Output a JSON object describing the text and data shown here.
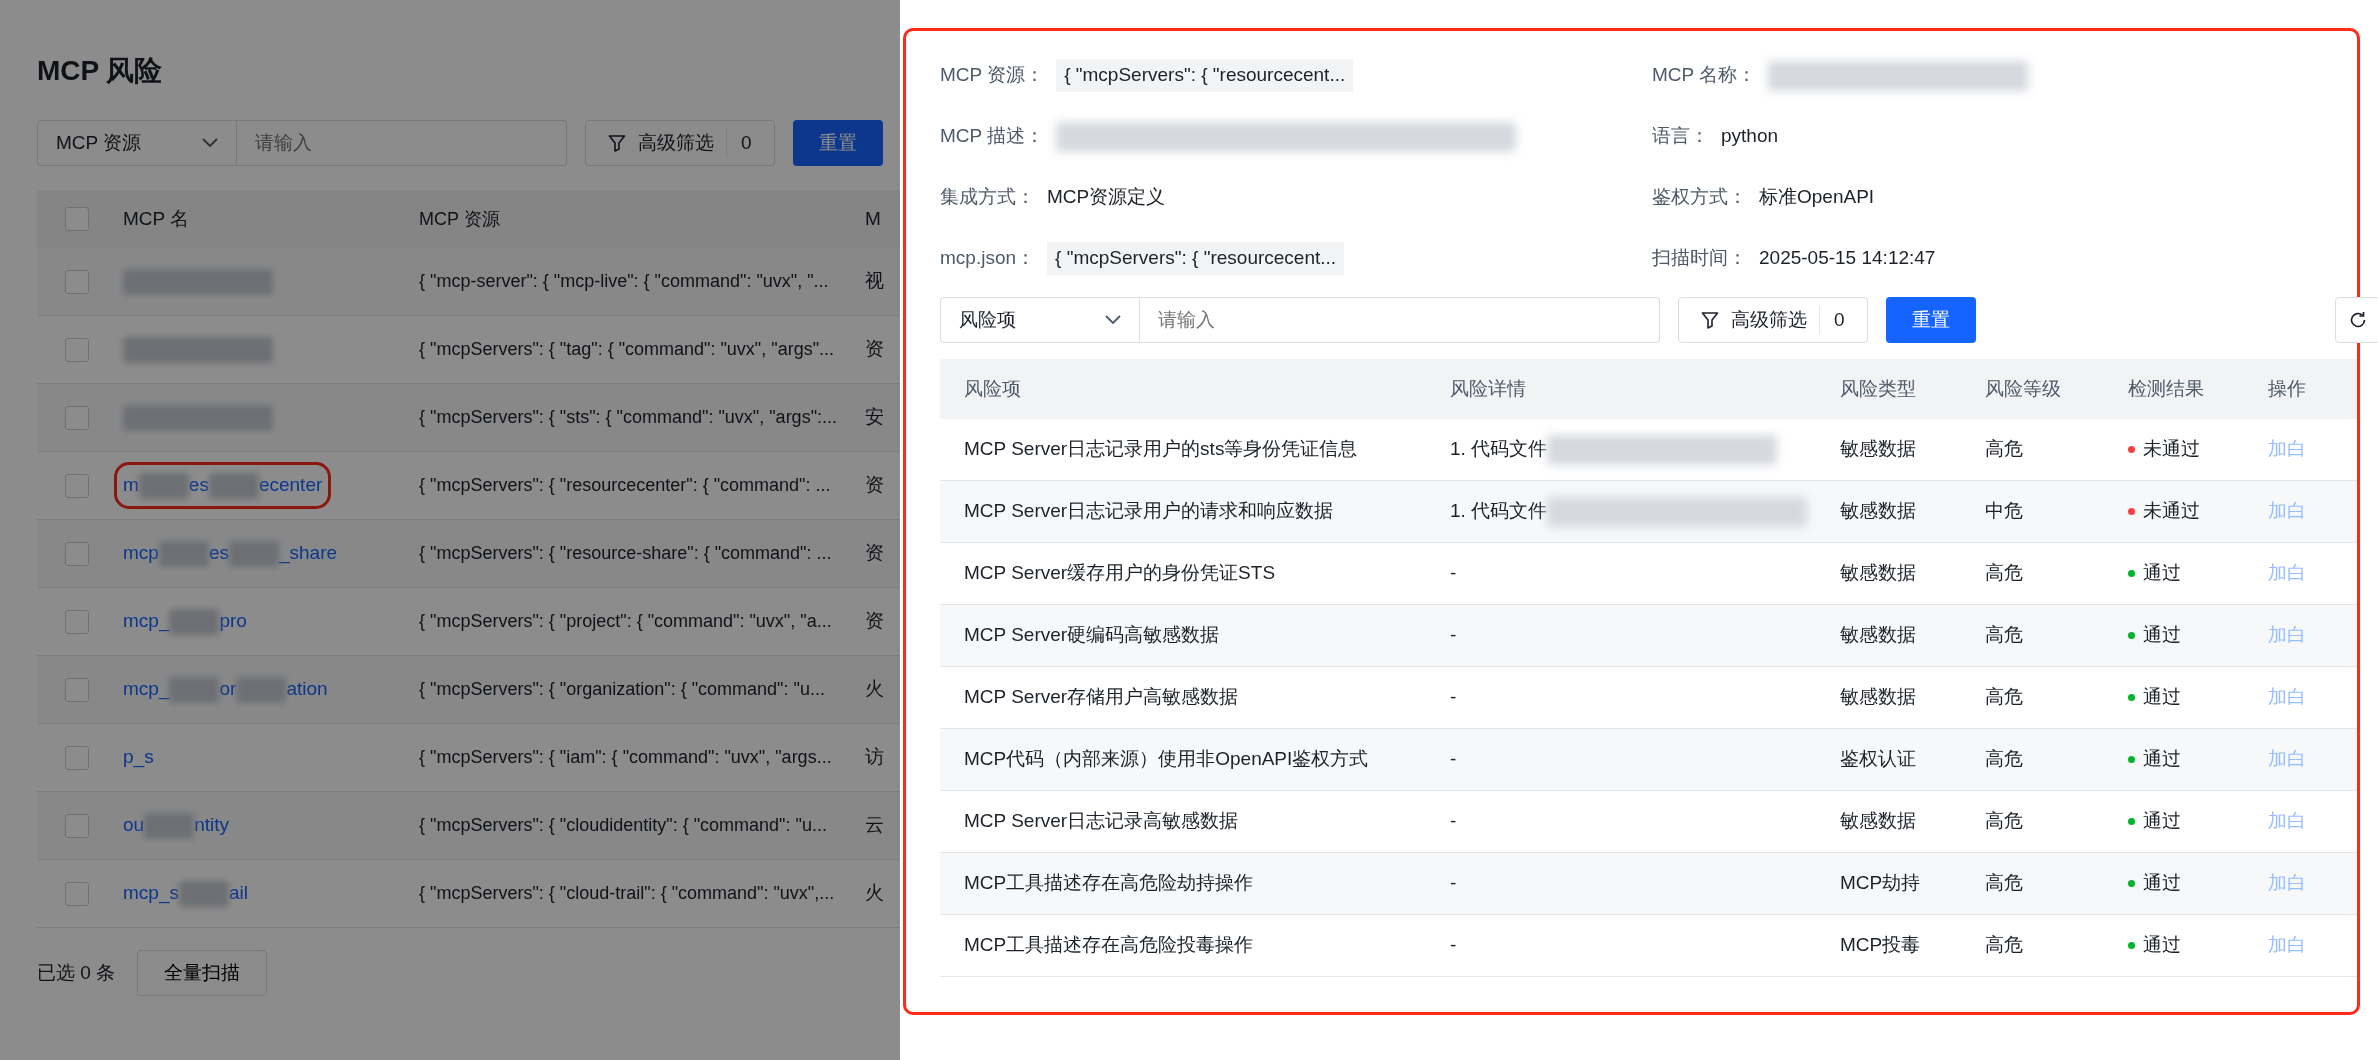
{
  "background_page": {
    "title": "MCP 风险",
    "filter": {
      "field_select": "MCP 资源",
      "placeholder": "请输入",
      "advanced_filter": "高级筛选",
      "filter_count": "0",
      "reset": "重置"
    },
    "table": {
      "select_all_checked": false,
      "columns": [
        "MCP 名",
        "MCP 资源",
        "M"
      ],
      "rows": [
        {
          "name_fragments": [],
          "resource": "{ \"mcp-server\": { \"mcp-live\": { \"command\": \"uvx\", \"...",
          "column_3": "视",
          "checked": false,
          "highlighted": false
        },
        {
          "name_fragments": [],
          "resource": "{ \"mcpServers\": { \"tag\": { \"command\": \"uvx\", \"args\"...",
          "column_3": "资",
          "checked": false,
          "highlighted": false
        },
        {
          "name_fragments": [],
          "resource": "{ \"mcpServers\": { \"sts\": { \"command\": \"uvx\", \"args\":...",
          "column_3": "安",
          "checked": false,
          "highlighted": false
        },
        {
          "name_fragments": [
            "m",
            "es",
            "ecenter"
          ],
          "resource": "{ \"mcpServers\": { \"resourcecenter\": { \"command\": ...",
          "column_3": "资",
          "checked": false,
          "highlighted": true
        },
        {
          "name_fragments": [
            "mcp",
            "es",
            "_share"
          ],
          "resource": "{ \"mcpServers\": { \"resource-share\": { \"command\": ...",
          "column_3": "资",
          "checked": false,
          "highlighted": false
        },
        {
          "name_fragments": [
            "mcp_",
            "pro"
          ],
          "resource": "{ \"mcpServers\": { \"project\": { \"command\": \"uvx\", \"a...",
          "column_3": "资",
          "checked": false,
          "highlighted": false
        },
        {
          "name_fragments": [
            "mcp_",
            "or",
            "ation"
          ],
          "resource": "{ \"mcpServers\": { \"organization\": { \"command\": \"u...",
          "column_3": "火",
          "checked": false,
          "highlighted": false
        },
        {
          "name_fragments": [
            "p_s"
          ],
          "resource": "{ \"mcpServers\": { \"iam\": { \"command\": \"uvx\", \"args...",
          "column_3": "访",
          "checked": false,
          "highlighted": false
        },
        {
          "name_fragments": [
            "ou",
            "ntity"
          ],
          "resource": "{ \"mcpServers\": { \"cloudidentity\": { \"command\": \"u...",
          "column_3": "云",
          "checked": false,
          "highlighted": false
        },
        {
          "name_fragments": [
            "mcp_s",
            "ail"
          ],
          "resource": "{ \"mcpServers\": { \"cloud-trail\": { \"command\": \"uvx\",...",
          "column_3": "火",
          "checked": false,
          "highlighted": false
        }
      ]
    },
    "footer": {
      "selected_count": "已选 0 条",
      "scan_all": "全量扫描"
    }
  },
  "drawer": {
    "details": [
      {
        "label": "MCP 资源：",
        "value": "{ \"mcpServers\": { \"resourcecent...",
        "kind": "code"
      },
      {
        "label": "MCP 名称：",
        "kind": "redacted"
      },
      {
        "label": "MCP 描述：",
        "kind": "redacted"
      },
      {
        "label": "语言：",
        "value": "python",
        "kind": "text"
      },
      {
        "label": "集成方式：",
        "value": "MCP资源定义",
        "kind": "text"
      },
      {
        "label": "鉴权方式：",
        "value": "标准OpenAPI",
        "kind": "text"
      },
      {
        "label": "mcp.json：",
        "value": "{ \"mcpServers\": { \"resourcecent...",
        "kind": "code"
      },
      {
        "label": "扫描时间：",
        "value": "2025-05-15 14:12:47",
        "kind": "text"
      }
    ],
    "filter": {
      "field_select": "风险项",
      "placeholder": "请输入",
      "advanced_filter": "高级筛选",
      "filter_count": "0",
      "reset": "重置"
    },
    "table": {
      "columns": [
        "风险项",
        "风险详情",
        "风险类型",
        "风险等级",
        "检测结果",
        "操作"
      ],
      "rows": [
        {
          "item": "MCP Server日志记录用户的sts等身份凭证信息",
          "detail": "1. 代码文件",
          "detail_redacted": true,
          "type": "敏感数据",
          "level": "高危",
          "result": "未通过",
          "passed": false,
          "action": "加白"
        },
        {
          "item": "MCP Server日志记录用户的请求和响应数据",
          "detail": "1. 代码文件",
          "detail_redacted": true,
          "type": "敏感数据",
          "level": "中危",
          "result": "未通过",
          "passed": false,
          "action": "加白"
        },
        {
          "item": "MCP Server缓存用户的身份凭证STS",
          "detail": "-",
          "detail_redacted": false,
          "type": "敏感数据",
          "level": "高危",
          "result": "通过",
          "passed": true,
          "action": "加白"
        },
        {
          "item": "MCP Server硬编码高敏感数据",
          "detail": "-",
          "detail_redacted": false,
          "type": "敏感数据",
          "level": "高危",
          "result": "通过",
          "passed": true,
          "action": "加白"
        },
        {
          "item": "MCP Server存储用户高敏感数据",
          "detail": "-",
          "detail_redacted": false,
          "type": "敏感数据",
          "level": "高危",
          "result": "通过",
          "passed": true,
          "action": "加白"
        },
        {
          "item": "MCP代码（内部来源）使用非OpenAPI鉴权方式",
          "detail": "-",
          "detail_redacted": false,
          "type": "鉴权认证",
          "level": "高危",
          "result": "通过",
          "passed": true,
          "action": "加白"
        },
        {
          "item": "MCP Server日志记录高敏感数据",
          "detail": "-",
          "detail_redacted": false,
          "type": "敏感数据",
          "level": "高危",
          "result": "通过",
          "passed": true,
          "action": "加白"
        },
        {
          "item": "MCP工具描述存在高危险劫持操作",
          "detail": "-",
          "detail_redacted": false,
          "type": "MCP劫持",
          "level": "高危",
          "result": "通过",
          "passed": true,
          "action": "加白"
        },
        {
          "item": "MCP工具描述存在高危险投毒操作",
          "detail": "-",
          "detail_redacted": false,
          "type": "MCP投毒",
          "level": "高危",
          "result": "通过",
          "passed": true,
          "action": "加白"
        }
      ]
    }
  }
}
